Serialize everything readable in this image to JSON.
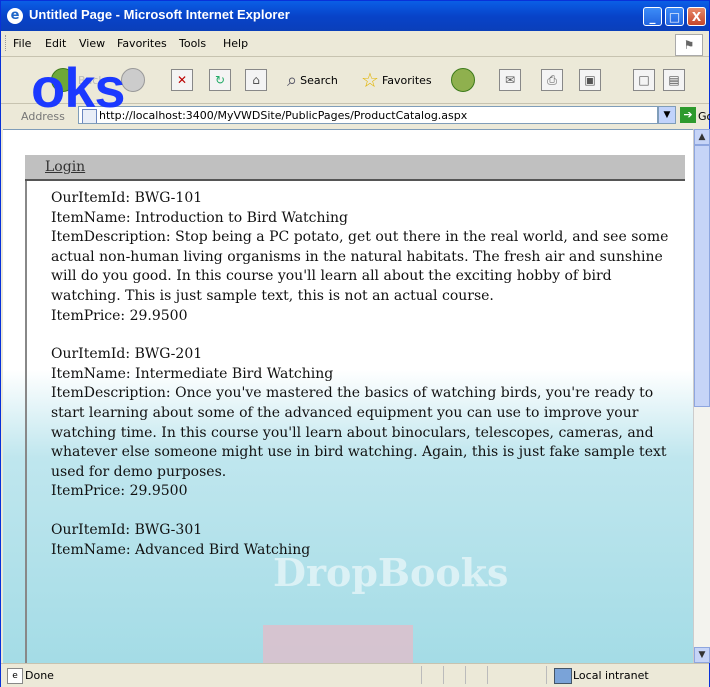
{
  "window": {
    "title": "Untitled Page - Microsoft Internet Explorer",
    "minimize": "_",
    "maximize": "□",
    "close": "X"
  },
  "menu": [
    "File",
    "Edit",
    "View",
    "Favorites",
    "Tools",
    "Help"
  ],
  "toolbar": {
    "back": "Back",
    "search": "Search",
    "favorites": "Favorites"
  },
  "address": {
    "label": "Address",
    "url": "http://localhost:3400/MyVWDSite/PublicPages/ProductCatalog.aspx",
    "go": "Go"
  },
  "watermark": {
    "logo_text": "oks",
    "brand": "DropBooks"
  },
  "page": {
    "login": "Login",
    "items": [
      {
        "id_line": "OurItemId: BWG-101",
        "name_line": "ItemName: Introduction to Bird Watching",
        "desc_line": "ItemDescription: Stop being a PC potato, get out there in the real world, and see some actual non-human living organisms in the natural habitats. The fresh air and sunshine will do you good. In this course you'll learn all about the exciting hobby of bird watching. This is just sample text, this is not an actual course.",
        "price_line": "ItemPrice: 29.9500"
      },
      {
        "id_line": "OurItemId: BWG-201",
        "name_line": "ItemName: Intermediate Bird Watching",
        "desc_line": "ItemDescription: Once you've mastered the basics of watching birds, you're ready to start learning about some of the advanced equipment you can use to improve your watching time. In this course you'll learn about binoculars, telescopes, cameras, and whatever else someone might use in bird watching. Again, this is just fake sample text used for demo purposes.",
        "price_line": "ItemPrice: 29.9500"
      },
      {
        "id_line": "OurItemId: BWG-301",
        "name_line": "ItemName: Advanced Bird Watching",
        "desc_line": "",
        "price_line": ""
      }
    ]
  },
  "status": {
    "text": "Done",
    "zone": "Local intranet"
  }
}
